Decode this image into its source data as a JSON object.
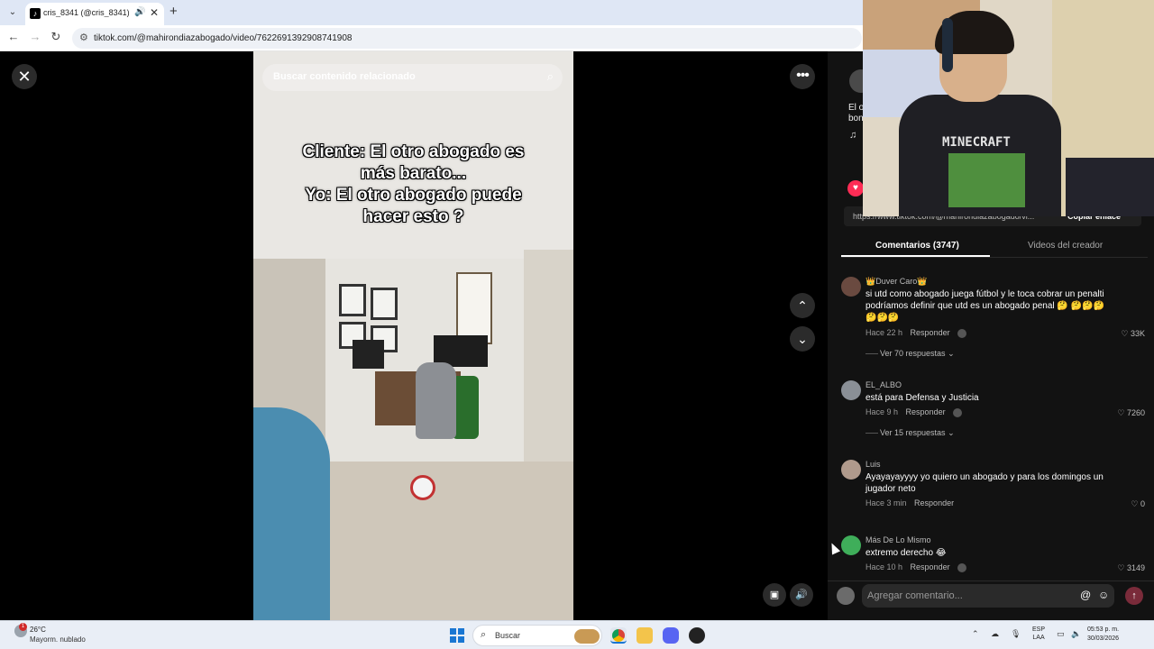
{
  "browser": {
    "tab_title": "cris_8341 (@cris_8341) | Tik",
    "tab_favicon": "tiktok-icon",
    "url": "tiktok.com/@mahirondiazabogado/video/7622691392908741908",
    "new_tab_label": "+"
  },
  "video": {
    "search_placeholder": "Buscar contenido relacionado",
    "caption": "Cliente: El otro abogado es\nmás barato...\nYo: El otro abogado puede\nhacer esto ?"
  },
  "side": {
    "partial_desc": "El o\nbon",
    "link": "https://www.tiktok.com/@mahirondiazabogado/vi...",
    "copy_label": "Copiar enlace",
    "tabs": [
      {
        "label": "Comentarios (3747)",
        "active": true
      },
      {
        "label": "Videos del creador",
        "active": false
      }
    ],
    "comments": [
      {
        "user": "👑Duver Caro👑",
        "text": "si utd como abogado juega fútbol y le toca cobrar un penalti podríamos definir que utd es un abogado penal 🤔 🤔🤔🤔🤔🤔🤔",
        "time": "Hace 22 h",
        "reply": "Responder",
        "likes": "33K",
        "replies": "Ver 70 respuestas",
        "avatar_color": "#6a4a40"
      },
      {
        "user": "EL_ALBO",
        "text": "está para Defensa y Justicia",
        "time": "Hace 9 h",
        "reply": "Responder",
        "likes": "7260",
        "replies": "Ver 15 respuestas",
        "avatar_color": "#8a8f96"
      },
      {
        "user": "Luis",
        "text": "Ayayayayyyy yo quiero un abogado y para los domingos un jugador neto",
        "time": "Hace 3 min",
        "reply": "Responder",
        "likes": "0",
        "replies": "",
        "avatar_color": "#b09a8c"
      },
      {
        "user": "Más De Lo Mismo",
        "text": "extremo derecho 😂",
        "time": "Hace 10 h",
        "reply": "Responder",
        "likes": "3149",
        "replies": "",
        "avatar_color": "#3fae5a"
      }
    ],
    "comment_placeholder": "Agregar comentario...",
    "at_label": "@",
    "emoji_label": "☺"
  },
  "webcam": {
    "shirt_text": "MINECRAFT"
  },
  "taskbar": {
    "temperature": "26°C",
    "condition": "Mayorm. nublado",
    "weather_badge": "1",
    "search_label": "Buscar",
    "language": "ESP\nLAA",
    "time": "05:53 p. m.",
    "date": "30/03/2026"
  },
  "colors": {
    "tiktok_red": "#fe2c55",
    "panel_bg": "#121212",
    "windows_blue": "#1976d2"
  }
}
